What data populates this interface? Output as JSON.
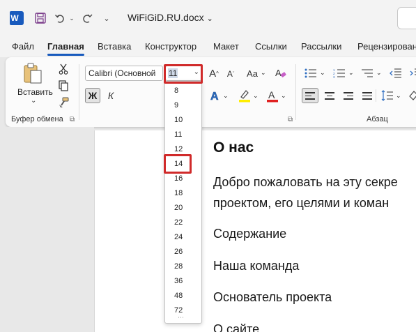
{
  "title_bar": {
    "doc_title": "WiFiGiD.RU.docx",
    "logo_letter": "W"
  },
  "tabs": [
    "Файл",
    "Главная",
    "Вставка",
    "Конструктор",
    "Макет",
    "Ссылки",
    "Рассылки",
    "Рецензирован"
  ],
  "active_tab": "Главная",
  "clipboard": {
    "paste_label": "Вставить",
    "group_label": "Буфер обмена"
  },
  "font": {
    "name": "Calibri (Основной",
    "size": "11",
    "bold_label": "Ж",
    "italic_label": "К",
    "grow_label": "A",
    "shrink_label": "A",
    "case_label": "Aa",
    "font_color_label": "A"
  },
  "paragraph": {
    "group_label": "Абзац"
  },
  "font_size_list": [
    "8",
    "9",
    "10",
    "11",
    "12",
    "14",
    "16",
    "18",
    "20",
    "22",
    "24",
    "26",
    "28",
    "36",
    "48",
    "72"
  ],
  "highlighted_size": "14",
  "document": {
    "heading": "О нас",
    "line1": "Добро пожаловать на эту секре",
    "line2": "проектом, его целями и коман",
    "item1": "Содержание",
    "item2": "Наша команда",
    "item3": "Основатель проекта",
    "item4": "О сайте"
  },
  "colors": {
    "accent": "#185abd",
    "highlight_red": "#d02a2a",
    "font_color_bar": "#e02020",
    "highlight_bar": "#ffee00"
  }
}
